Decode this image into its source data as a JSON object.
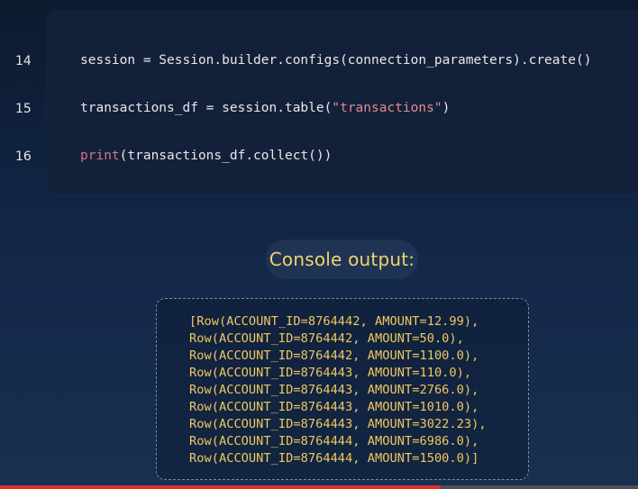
{
  "code": {
    "lines": [
      {
        "num": "14",
        "text": "session = Session.builder.configs(connection_parameters).create()"
      },
      {
        "num": "15",
        "pre": "transactions_df = session.table(",
        "str": "\"transactions\"",
        "post": ")"
      },
      {
        "num": "16",
        "kw": "print",
        "post": "(transactions_df.collect())"
      }
    ]
  },
  "console_label": "Console output:",
  "output_lines": [
    "[Row(ACCOUNT_ID=8764442, AMOUNT=12.99),",
    "Row(ACCOUNT_ID=8764442, AMOUNT=50.0),",
    "Row(ACCOUNT_ID=8764442, AMOUNT=1100.0),",
    "Row(ACCOUNT_ID=8764443, AMOUNT=110.0),",
    "Row(ACCOUNT_ID=8764443, AMOUNT=2766.0),",
    "Row(ACCOUNT_ID=8764443, AMOUNT=1010.0),",
    "Row(ACCOUNT_ID=8764443, AMOUNT=3022.23),",
    "Row(ACCOUNT_ID=8764444, AMOUNT=6986.0),",
    "Row(ACCOUNT_ID=8764444, AMOUNT=1500.0)]"
  ],
  "video_progress": 0.69,
  "colors": {
    "accent_progress": "#e0302a",
    "console_text": "#f0c760",
    "string_literal": "#e38b8b"
  }
}
